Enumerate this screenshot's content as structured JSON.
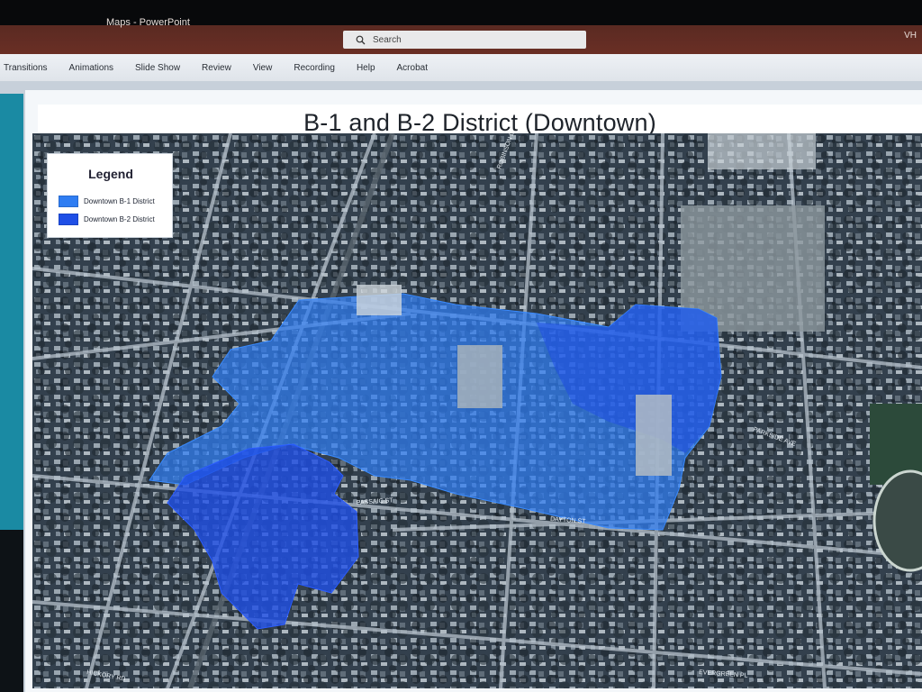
{
  "app": {
    "title": "Maps - PowerPoint",
    "search_label": "Search",
    "user_initials": "VH"
  },
  "ribbon": {
    "tabs": [
      "Transitions",
      "Animations",
      "Slide Show",
      "Review",
      "View",
      "Recording",
      "Help",
      "Acrobat"
    ]
  },
  "slide": {
    "title": "B-1 and B-2 District (Downtown)"
  },
  "legend": {
    "title": "Legend",
    "items": [
      {
        "label": "Downtown B-1 District",
        "color": "#2f7df2"
      },
      {
        "label": "Downtown B-2 District",
        "color": "#1f4fe6"
      }
    ]
  },
  "map": {
    "street_labels": [
      "PASSAIC ST",
      "DAYTON ST",
      "PARKSIDE AVE",
      "ROBINSON LN",
      "EVERGREEN PL",
      "HICKORY RD"
    ]
  },
  "colors": {
    "b1_district": "#2f7df2",
    "b2_district": "#1f4fe6",
    "titlebar": "#6b2f25",
    "ribbon": "#e6eaef"
  }
}
